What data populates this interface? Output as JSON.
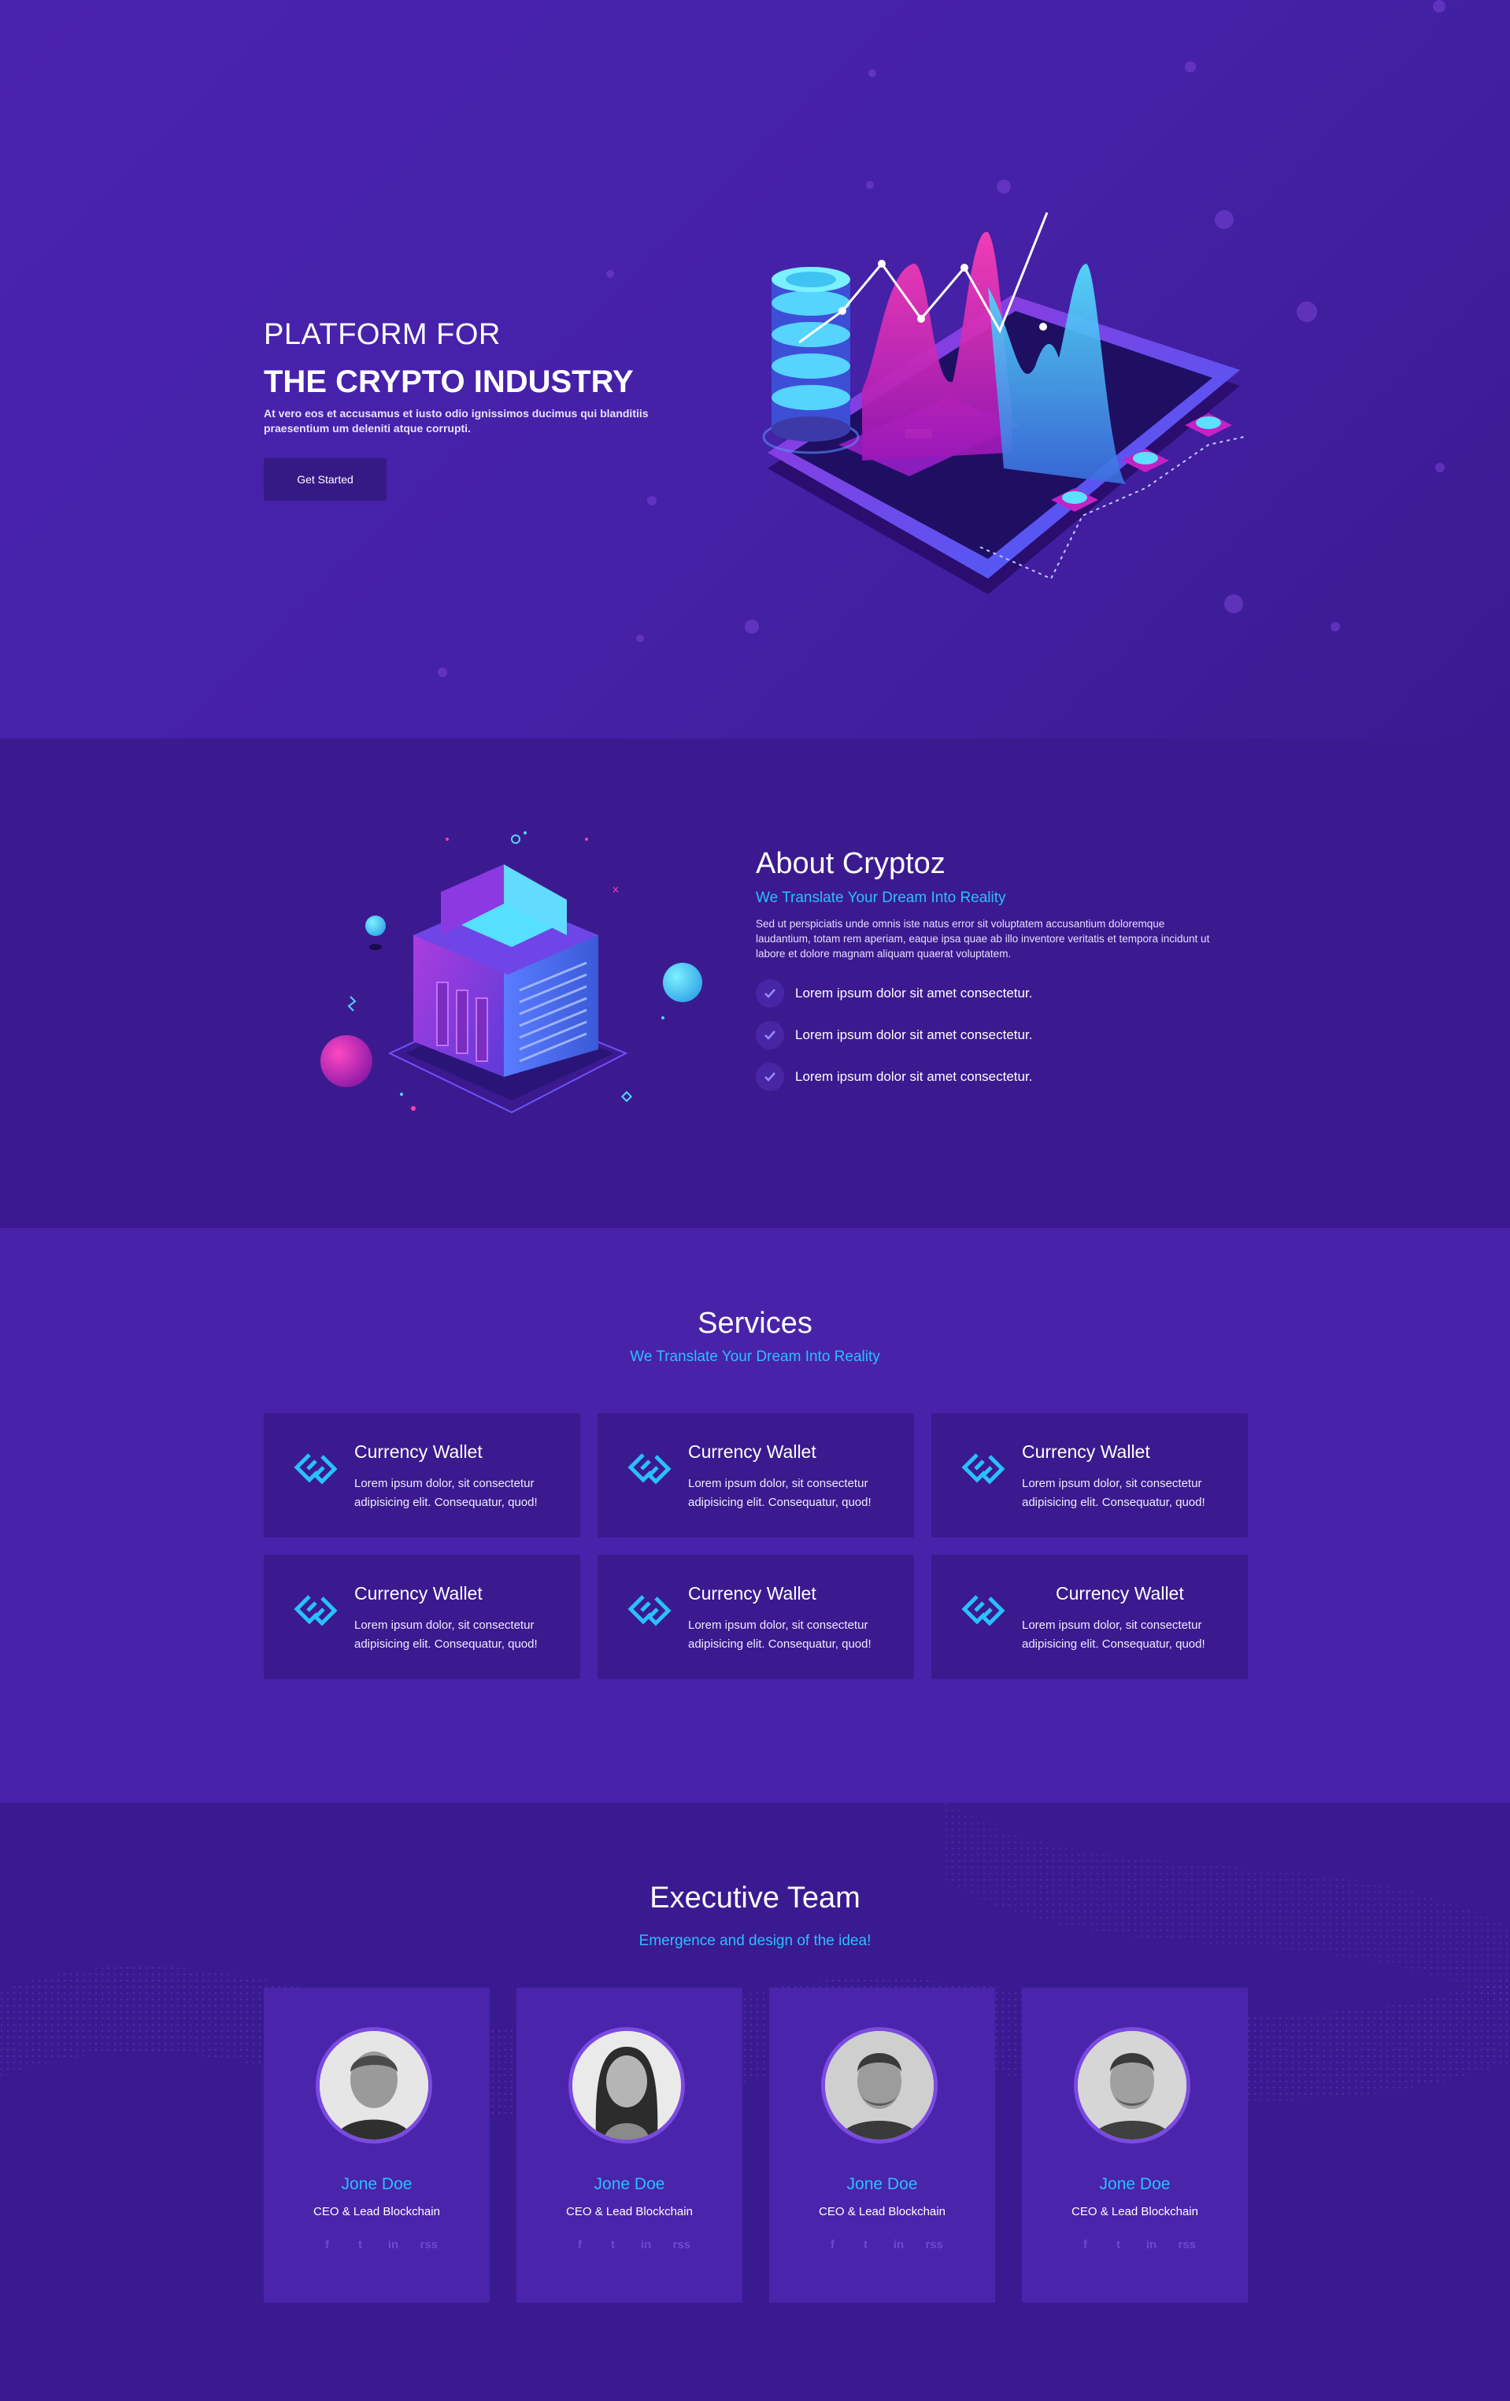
{
  "hero": {
    "pre_title": "PLATFORM FOR",
    "title": "THE CRYPTO INDUSTRY",
    "description": "At vero eos et accusamus et iusto odio ignissimos ducimus qui blanditiis praesentium um deleniti atque corrupti.",
    "button_label": "Get Started"
  },
  "about": {
    "title": "About Cryptoz",
    "subtitle": "We Translate Your Dream Into Reality",
    "description": "Sed ut perspiciatis unde omnis iste natus error sit voluptatem accusantium doloremque laudantium, totam rem aperiam, eaque ipsa quae ab illo inventore veritatis et tempora incidunt ut labore et dolore magnam aliquam quaerat voluptatem.",
    "checklist": [
      "Lorem ipsum dolor sit amet consectetur.",
      "Lorem ipsum dolor sit amet consectetur.",
      "Lorem ipsum dolor sit amet consectetur."
    ]
  },
  "services": {
    "title": "Services",
    "subtitle": "We Translate Your Dream Into Reality",
    "items": [
      {
        "title": "Currency Wallet",
        "description": "Lorem ipsum dolor, sit consectetur adipisicing elit. Consequatur, quod!",
        "icon": "link-icon"
      },
      {
        "title": "Currency Wallet",
        "description": "Lorem ipsum dolor, sit consectetur adipisicing elit. Consequatur, quod!",
        "icon": "link-icon"
      },
      {
        "title": "Currency Wallet",
        "description": "Lorem ipsum dolor, sit consectetur adipisicing elit. Consequatur, quod!",
        "icon": "link-icon"
      },
      {
        "title": "Currency Wallet",
        "description": "Lorem ipsum dolor, sit consectetur adipisicing elit. Consequatur, quod!",
        "icon": "link-icon"
      },
      {
        "title": "Currency Wallet",
        "description": "Lorem ipsum dolor, sit consectetur adipisicing elit. Consequatur, quod!",
        "icon": "link-icon"
      },
      {
        "title": "Currency Wallet",
        "description": "Lorem ipsum dolor, sit consectetur adipisicing elit. Consequatur, quod!",
        "icon": "link-icon"
      }
    ]
  },
  "team": {
    "title": "Executive Team",
    "subtitle": "Emergence and design of the idea!",
    "members": [
      {
        "name": "Jone Doe",
        "role": "CEO & Lead Blockchain"
      },
      {
        "name": "Jone Doe",
        "role": "CEO & Lead Blockchain"
      },
      {
        "name": "Jone Doe",
        "role": "CEO & Lead Blockchain"
      },
      {
        "name": "Jone Doe",
        "role": "CEO & Lead Blockchain"
      }
    ],
    "socials": [
      "f",
      "t",
      "in",
      "rss"
    ]
  },
  "colors": {
    "accent": "#29c0ff",
    "background_dark": "#3b1a8f",
    "background_mid": "#4823a9",
    "card": "#3a1a8e"
  }
}
